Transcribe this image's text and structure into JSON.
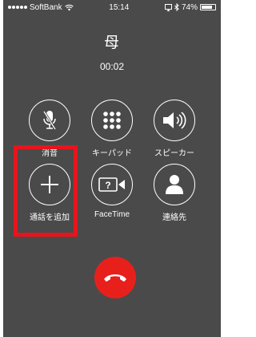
{
  "status": {
    "carrier": "SoftBank",
    "time": "15:14",
    "battery": "74%"
  },
  "call": {
    "caller": "母",
    "duration": "00:02"
  },
  "buttons": {
    "mute": "消音",
    "keypad": "キーパッド",
    "speaker": "スピーカー",
    "add_call": "通話を追加",
    "facetime": "FaceTime",
    "contacts": "連絡先"
  },
  "highlight_color": "#e8141c",
  "end_call_color": "#e8201c"
}
